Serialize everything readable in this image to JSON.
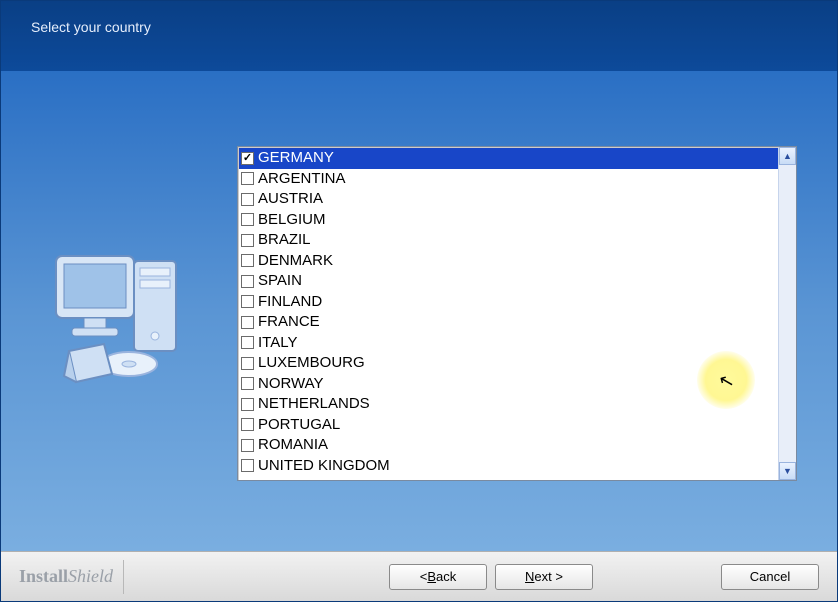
{
  "header": {
    "title": "Select your country"
  },
  "countries": [
    {
      "label": "GERMANY",
      "checked": true,
      "selected": true
    },
    {
      "label": "ARGENTINA",
      "checked": false,
      "selected": false
    },
    {
      "label": "AUSTRIA",
      "checked": false,
      "selected": false
    },
    {
      "label": "BELGIUM",
      "checked": false,
      "selected": false
    },
    {
      "label": "BRAZIL",
      "checked": false,
      "selected": false
    },
    {
      "label": "DENMARK",
      "checked": false,
      "selected": false
    },
    {
      "label": "SPAIN",
      "checked": false,
      "selected": false
    },
    {
      "label": "FINLAND",
      "checked": false,
      "selected": false
    },
    {
      "label": "FRANCE",
      "checked": false,
      "selected": false
    },
    {
      "label": "ITALY",
      "checked": false,
      "selected": false
    },
    {
      "label": "LUXEMBOURG",
      "checked": false,
      "selected": false
    },
    {
      "label": "NORWAY",
      "checked": false,
      "selected": false
    },
    {
      "label": "NETHERLANDS",
      "checked": false,
      "selected": false
    },
    {
      "label": "PORTUGAL",
      "checked": false,
      "selected": false
    },
    {
      "label": "ROMANIA",
      "checked": false,
      "selected": false
    },
    {
      "label": "UNITED KINGDOM",
      "checked": false,
      "selected": false
    }
  ],
  "footer": {
    "brand_bold": "Install",
    "brand_light": "Shield",
    "back_prefix": "< ",
    "back_u": "B",
    "back_rest": "ack",
    "next_u": "N",
    "next_rest": "ext >",
    "cancel": "Cancel"
  },
  "scroll": {
    "up": "▲",
    "down": "▼"
  }
}
